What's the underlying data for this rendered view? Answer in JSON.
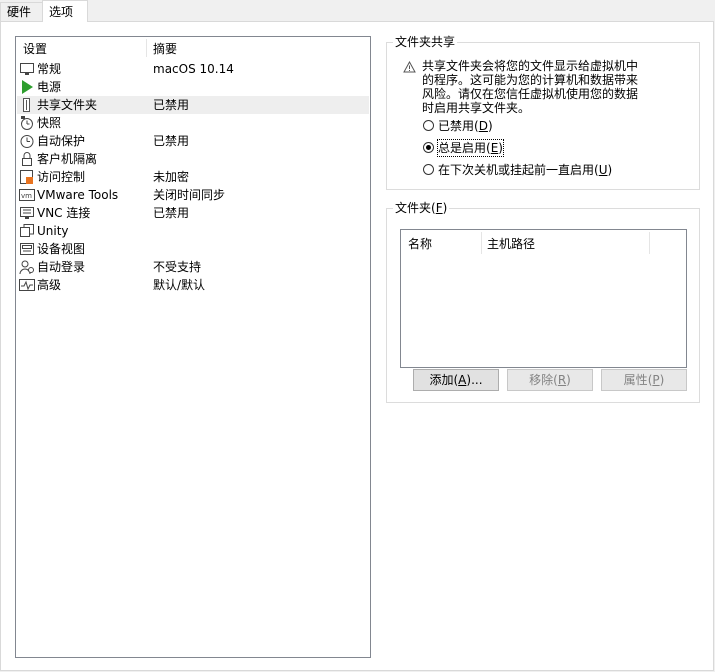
{
  "tabs": [
    {
      "label": "硬件",
      "active": false
    },
    {
      "label": "选项",
      "active": true
    }
  ],
  "settings_list": {
    "columns": {
      "setting": "设置",
      "summary": "摘要"
    },
    "rows": [
      {
        "icon": "monitor-icon",
        "name": "常规",
        "summary": "macOS 10.14"
      },
      {
        "icon": "power-play-icon",
        "name": "电源",
        "summary": ""
      },
      {
        "icon": "shared-folder-icon",
        "name": "共享文件夹",
        "summary": "已禁用",
        "selected": true
      },
      {
        "icon": "snapshot-clock-icon",
        "name": "快照",
        "summary": ""
      },
      {
        "icon": "autoprotect-clock-icon",
        "name": "自动保护",
        "summary": "已禁用"
      },
      {
        "icon": "lock-icon",
        "name": "客户机隔离",
        "summary": ""
      },
      {
        "icon": "access-control-icon",
        "name": "访问控制",
        "summary": "未加密"
      },
      {
        "icon": "vm-tools-icon",
        "name": "VMware Tools",
        "summary": "关闭时间同步"
      },
      {
        "icon": "vnc-icon",
        "name": "VNC 连接",
        "summary": "已禁用"
      },
      {
        "icon": "unity-icon",
        "name": "Unity",
        "summary": ""
      },
      {
        "icon": "appliance-view-icon",
        "name": "设备视图",
        "summary": ""
      },
      {
        "icon": "autologin-user-icon",
        "name": "自动登录",
        "summary": "不受支持"
      },
      {
        "icon": "advanced-pulse-icon",
        "name": "高级",
        "summary": "默认/默认"
      }
    ]
  },
  "folder_sharing": {
    "title": "文件夹共享",
    "warning_icon": "warning-triangle-icon",
    "warning_lines": [
      "共享文件夹会将您的文件显示给虚拟机中",
      "的程序。这可能为您的计算机和数据带来",
      "风险。请仅在您信任虚拟机使用您的数据",
      "时启用共享文件夹。"
    ],
    "options": [
      {
        "label": "已禁用",
        "key": "D",
        "checked": false
      },
      {
        "label": "总是启用",
        "key": "E",
        "checked": true
      },
      {
        "label": "在下次关机或挂起前一直启用",
        "key": "U",
        "checked": false
      }
    ]
  },
  "folders": {
    "title": "文件夹",
    "title_key": "F",
    "columns": {
      "name": "名称",
      "host_path": "主机路径"
    },
    "buttons": {
      "add": {
        "label": "添加",
        "key": "A",
        "suffix": "..."
      },
      "remove": {
        "label": "移除",
        "key": "R"
      },
      "properties": {
        "label": "属性",
        "key": "P"
      }
    }
  }
}
